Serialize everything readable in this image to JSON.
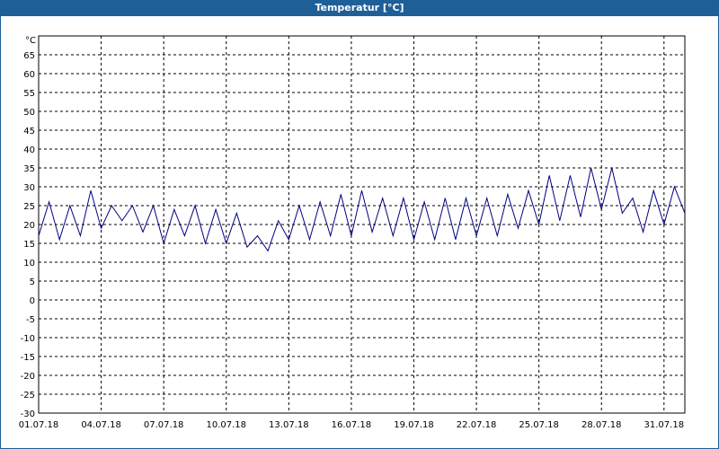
{
  "window": {
    "title": "Temperatur [°C]"
  },
  "chart_data": {
    "type": "line",
    "title": "Temperatur [°C]",
    "ylabel": "°C",
    "xlabel": "",
    "ylim": [
      -30,
      70
    ],
    "yticks": [
      -30,
      -25,
      -20,
      -15,
      -10,
      -5,
      0,
      5,
      10,
      15,
      20,
      25,
      30,
      35,
      40,
      45,
      50,
      55,
      60,
      65
    ],
    "xlim": [
      "01.07.18",
      "01.08.18"
    ],
    "xticks": [
      "01.07.18",
      "04.07.18",
      "07.07.18",
      "10.07.18",
      "13.07.18",
      "16.07.18",
      "19.07.18",
      "22.07.18",
      "25.07.18",
      "28.07.18",
      "31.07.18"
    ],
    "grid": true,
    "line_color": "#000080",
    "series": [
      {
        "x": [
          "01.07.18 00:00",
          "01.07.18 12:00",
          "02.07.18 00:00",
          "02.07.18 12:00",
          "03.07.18 00:00",
          "03.07.18 12:00",
          "04.07.18 00:00",
          "04.07.18 12:00",
          "05.07.18 00:00",
          "05.07.18 12:00",
          "06.07.18 00:00",
          "06.07.18 12:00",
          "07.07.18 00:00",
          "07.07.18 12:00",
          "08.07.18 00:00",
          "08.07.18 12:00",
          "09.07.18 00:00",
          "09.07.18 12:00",
          "10.07.18 00:00",
          "10.07.18 12:00",
          "11.07.18 00:00",
          "11.07.18 12:00",
          "12.07.18 00:00",
          "12.07.18 12:00",
          "13.07.18 00:00",
          "13.07.18 12:00",
          "14.07.18 00:00",
          "14.07.18 12:00",
          "15.07.18 00:00",
          "15.07.18 12:00",
          "16.07.18 00:00",
          "16.07.18 12:00",
          "17.07.18 00:00",
          "17.07.18 12:00",
          "18.07.18 00:00",
          "18.07.18 12:00",
          "19.07.18 00:00",
          "19.07.18 12:00",
          "20.07.18 00:00",
          "20.07.18 12:00",
          "21.07.18 00:00",
          "21.07.18 12:00",
          "22.07.18 00:00",
          "22.07.18 12:00",
          "23.07.18 00:00",
          "23.07.18 12:00",
          "24.07.18 00:00",
          "24.07.18 12:00",
          "25.07.18 00:00",
          "25.07.18 12:00",
          "26.07.18 00:00",
          "26.07.18 12:00",
          "27.07.18 00:00",
          "27.07.18 12:00",
          "28.07.18 00:00",
          "28.07.18 12:00",
          "29.07.18 00:00",
          "29.07.18 12:00",
          "30.07.18 00:00",
          "30.07.18 12:00",
          "31.07.18 00:00",
          "31.07.18 12:00",
          "01.08.18 00:00"
        ],
        "y": [
          17,
          26,
          16,
          25,
          17,
          29,
          19,
          25,
          21,
          25,
          18,
          25,
          15,
          24,
          17,
          25,
          15,
          24,
          15,
          23,
          14,
          17,
          13,
          21,
          16,
          25,
          16,
          26,
          17,
          28,
          17,
          29,
          18,
          27,
          17,
          27,
          16,
          26,
          16,
          27,
          16,
          27,
          17,
          27,
          17,
          28,
          19,
          29,
          20,
          33,
          21,
          33,
          22,
          35,
          24,
          35,
          23,
          27,
          18,
          29,
          20,
          30,
          23
        ]
      }
    ]
  }
}
